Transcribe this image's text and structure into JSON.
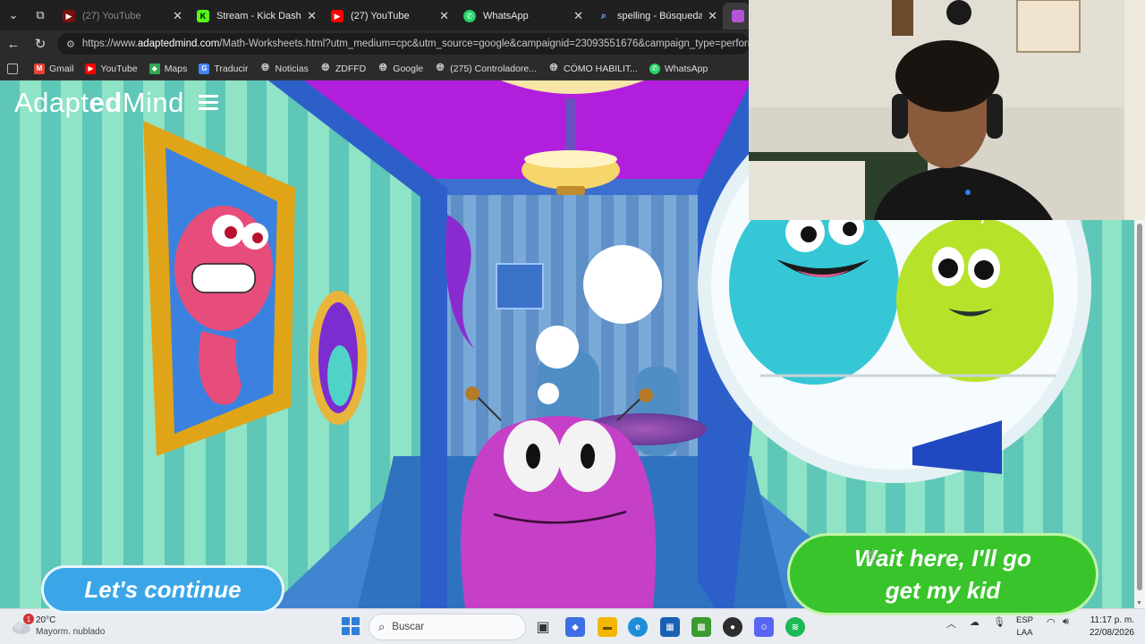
{
  "browser": {
    "tabs": [
      {
        "title": "(27) YouTube",
        "favicon_color": "#cc0000",
        "dim": true
      },
      {
        "title": "Stream - Kick Dashboard",
        "favicon_color": "#53fc18",
        "dim": false
      },
      {
        "title": "(27) YouTube",
        "favicon_color": "#ff0000",
        "dim": false
      },
      {
        "title": "WhatsApp",
        "favicon_color": "#25d366",
        "dim": false
      },
      {
        "title": "spelling - Búsqueda",
        "favicon_color": "#1a73e8",
        "dim": false
      }
    ],
    "url_prefix": "https://www.",
    "url_domain": "adaptedmind.com",
    "url_rest": "/Math-Worksheets.html?utm_medium=cpc&utm_source=google&campaignid=23093551676&campaign_type=performa",
    "bookmarks": [
      {
        "label": "Gmail",
        "icon": "gmail-icon",
        "color": "#ea4335"
      },
      {
        "label": "YouTube",
        "icon": "youtube-icon",
        "color": "#ff0000"
      },
      {
        "label": "Maps",
        "icon": "maps-icon",
        "color": "#34a853"
      },
      {
        "label": "Traducir",
        "icon": "translate-icon",
        "color": "#4285f4"
      },
      {
        "label": "Noticias",
        "icon": "globe-icon",
        "color": "#666666"
      },
      {
        "label": "ZDFFD",
        "icon": "globe-icon",
        "color": "#666666"
      },
      {
        "label": "Google",
        "icon": "globe-icon",
        "color": "#666666"
      },
      {
        "label": "(275) Controladore...",
        "icon": "globe-icon",
        "color": "#666666"
      },
      {
        "label": "CÓMO HABILIT...",
        "icon": "globe-icon",
        "color": "#666666"
      },
      {
        "label": "WhatsApp",
        "icon": "whatsapp-icon",
        "color": "#25d366"
      }
    ]
  },
  "game": {
    "logo_pre": "Adapt",
    "logo_bold": "ed",
    "logo_post": "Mind",
    "continue_label": "Let's continue",
    "wait_line1": "Wait here, I'll go",
    "wait_line2": "get my kid"
  },
  "taskbar": {
    "temperature": "20°C",
    "weather": "Mayorm. nublado",
    "weather_badge": "1",
    "search_placeholder": "Buscar",
    "lang_line1": "ESP",
    "lang_line2": "LAA",
    "time": "11:17 p. m.",
    "date": "22/08/2026"
  },
  "colors": {
    "wall_stripe_light": "#8ee0c4",
    "wall_stripe_dark": "#5cc3b4",
    "ceiling": "#b21fdc",
    "monster_purple": "#c83fc8",
    "button_blue": "#3aa6e8",
    "button_green": "#39c42c"
  }
}
